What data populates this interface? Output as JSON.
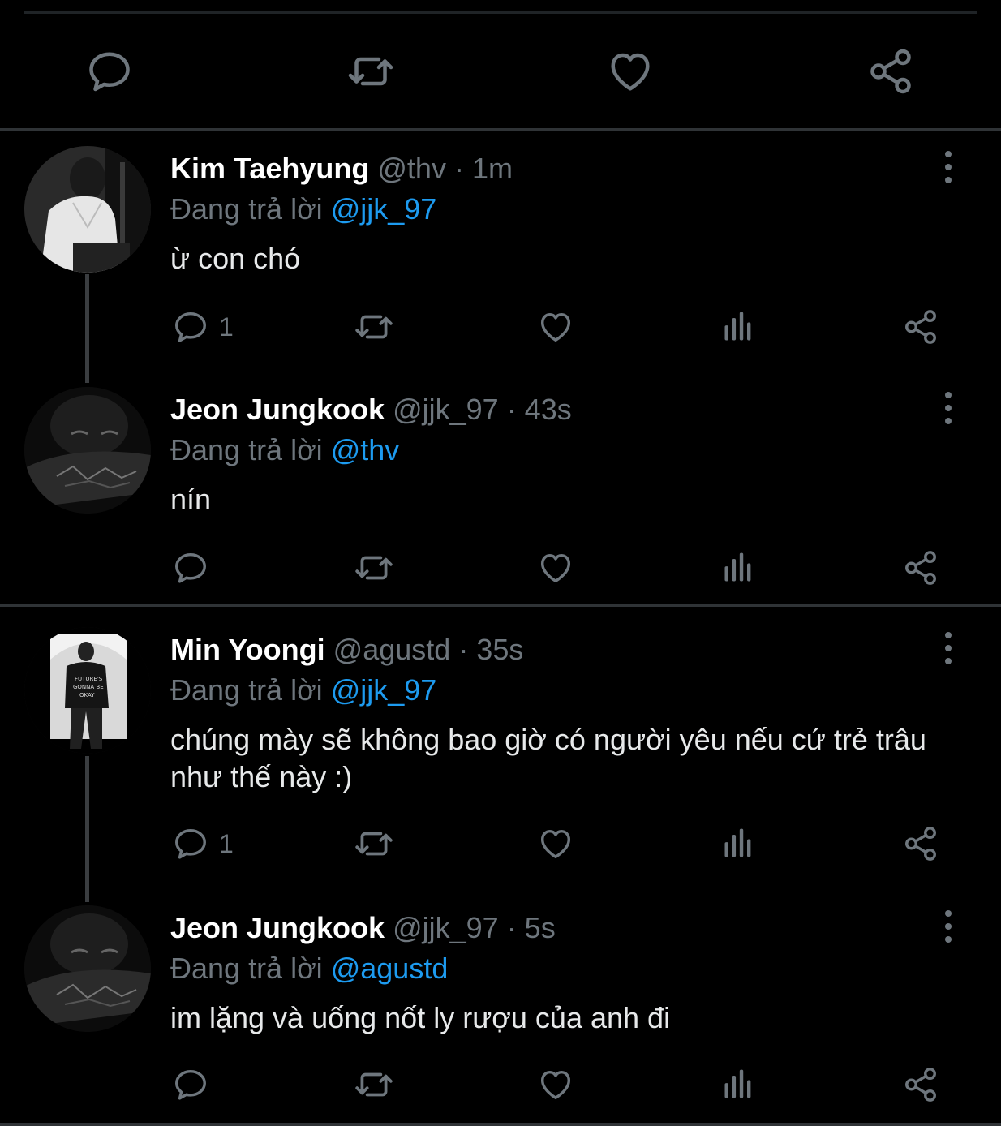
{
  "colors": {
    "background": "#000000",
    "text": "#e7e9ea",
    "muted": "#6e767d",
    "mention": "#1d9bf0",
    "divider": "#2f3336"
  },
  "icons": {
    "reply": "reply-icon",
    "retweet": "retweet-icon",
    "like": "heart-icon",
    "analytics": "analytics-icon",
    "share": "share-icon",
    "more": "more-icon"
  },
  "tweets": [
    {
      "name": "Kim Taehyung",
      "handle": "@thv",
      "time": "· 1m",
      "replying_label": "Đang trả lời",
      "replying_to": "@jjk_97",
      "text": "ừ con chó",
      "reply_count": "1"
    },
    {
      "name": "Jeon Jungkook",
      "handle": "@jjk_97",
      "time": "· 43s",
      "replying_label": "Đang trả lời",
      "replying_to": "@thv",
      "text": "nín",
      "reply_count": ""
    },
    {
      "name": "Min Yoongi",
      "handle": "@agustd",
      "time": "· 35s",
      "replying_label": "Đang trả lời",
      "replying_to": "@jjk_97",
      "text": "chúng mày sẽ không bao giờ có người yêu nếu cứ trẻ trâu như thế này :)",
      "reply_count": "1"
    },
    {
      "name": "Jeon Jungkook",
      "handle": "@jjk_97",
      "time": "· 5s",
      "replying_label": "Đang trả lời",
      "replying_to": "@agustd",
      "text": "im lặng và uống nốt ly rượu của anh đi",
      "reply_count": ""
    }
  ]
}
